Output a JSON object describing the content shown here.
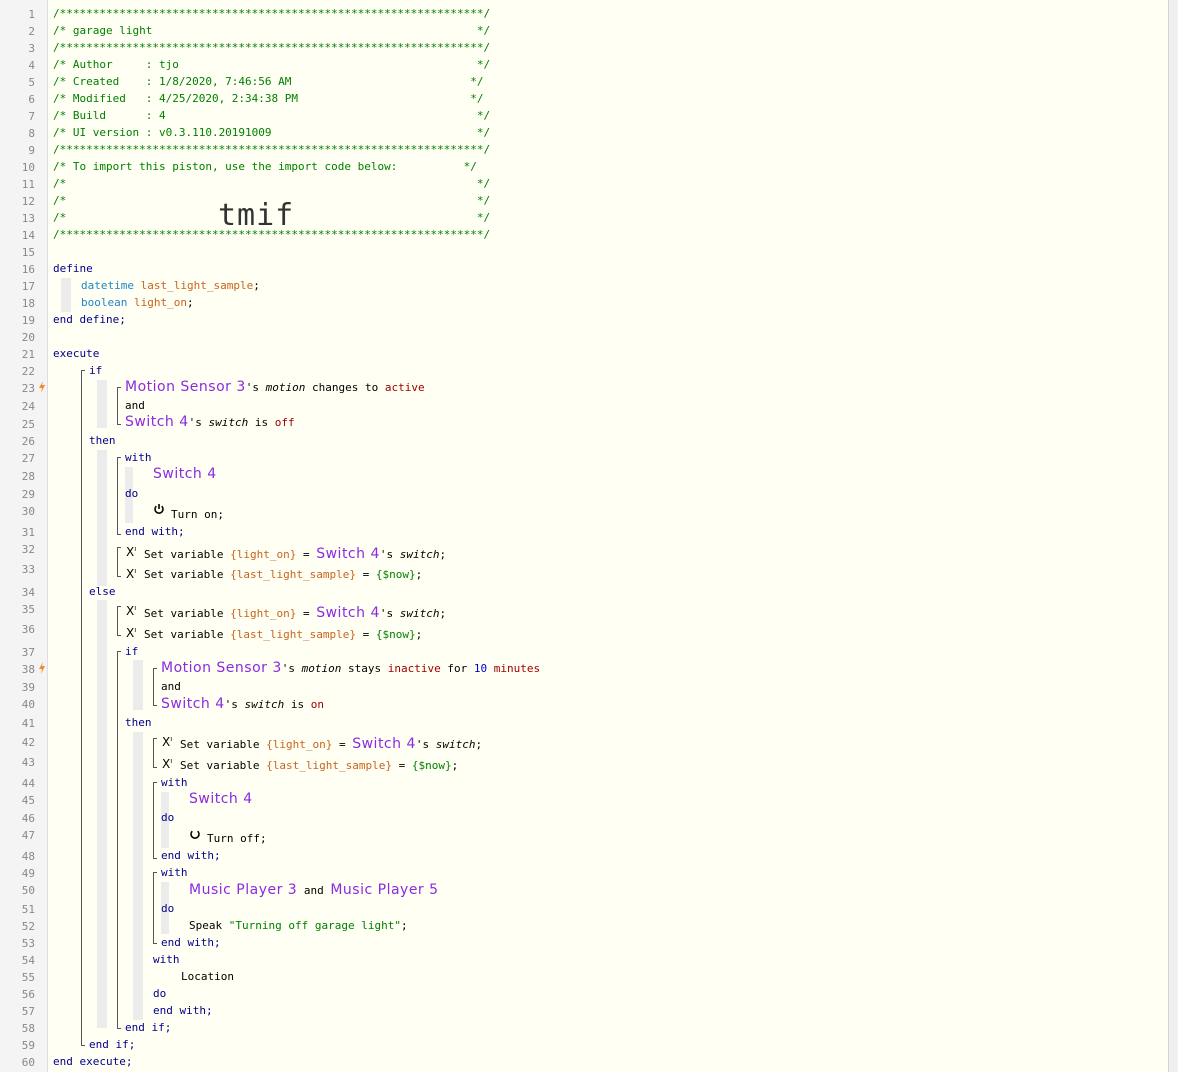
{
  "line_numbers": [
    "1",
    "2",
    "3",
    "4",
    "5",
    "6",
    "7",
    "8",
    "9",
    "10",
    "11",
    "12",
    "13",
    "14",
    "15",
    "16",
    "17",
    "18",
    "19",
    "20",
    "21",
    "22",
    "23",
    "24",
    "25",
    "26",
    "27",
    "28",
    "29",
    "30",
    "31",
    "32",
    "33",
    "34",
    "35",
    "36",
    "37",
    "38",
    "39",
    "40",
    "41",
    "42",
    "43",
    "44",
    "45",
    "46",
    "47",
    "48",
    "49",
    "50",
    "51",
    "52",
    "53",
    "54",
    "55",
    "56",
    "57",
    "58",
    "59",
    "60"
  ],
  "header": {
    "border": "/****************************************************************/",
    "title": "/* garage light                                                 */",
    "author": "/* Author     : tjo                                             */",
    "created": "/* Created    : 1/8/2020, 7:46:56 AM                           */",
    "modified": "/* Modified   : 4/25/2020, 2:34:38 PM                          */",
    "build": "/* Build      : 4                                               */",
    "ui_version": "/* UI version : v0.3.110.20191009                               */",
    "import_note": "/* To import this piston, use the import code below:          */",
    "blank": "/*                                                              */",
    "import_code": "tmif"
  },
  "code": {
    "define": "define",
    "datetime": "datetime",
    "last_light_sample": "last_light_sample",
    "boolean": "boolean",
    "light_on": "light_on",
    "semi": ";",
    "end_define": "end define;",
    "execute": "execute",
    "if": "if",
    "motion_sensor_3": "Motion Sensor 3",
    "apos_s": "'s",
    "motion": "motion",
    "changes_to": "changes to",
    "active": "active",
    "and": "and",
    "switch_4": "Switch 4",
    "switch_attr": "switch",
    "is": "is",
    "off": "off",
    "then": "then",
    "with": "with",
    "do": "do",
    "turn_on": "Turn on;",
    "end_with": "end with;",
    "set_variable": "Set variable",
    "light_on_ref": "{light_on}",
    "last_light_sample_ref": "{last_light_sample}",
    "equals": "=",
    "now": "{$now}",
    "else": "else",
    "stays": "stays",
    "inactive": "inactive",
    "for": "for",
    "ten": "10",
    "minutes": "minutes",
    "on": "on",
    "turn_off": "Turn off;",
    "music_player_3": "Music Player 3",
    "music_player_5": "Music Player 5",
    "speak": "Speak",
    "speak_text": "\"Turning off garage light\"",
    "location": "Location",
    "end_if": "end if;",
    "end_execute": "end execute;",
    "x_glyph": "X",
    "x_sup": "ı"
  }
}
